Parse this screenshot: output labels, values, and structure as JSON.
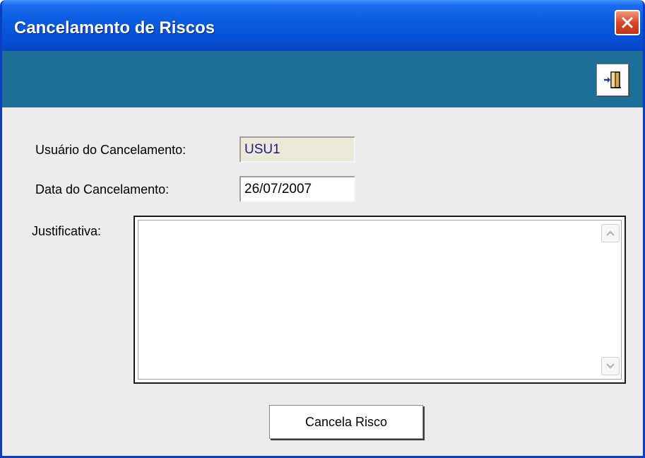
{
  "window": {
    "title": "Cancelamento de Riscos"
  },
  "toolbar": {
    "exit_icon": "exit-door-icon"
  },
  "form": {
    "usuario_label": "Usuário do Cancelamento:",
    "usuario_value": "USU1",
    "data_label": "Data do Cancelamento:",
    "data_value": "26/07/2007",
    "justificativa_label": "Justificativa:",
    "justificativa_value": ""
  },
  "actions": {
    "cancel_risk_label": "Cancela Risco"
  },
  "colors": {
    "titlebar": "#0550d6",
    "toolbar": "#1d6f98",
    "client": "#ececec",
    "close": "#d8482a"
  }
}
